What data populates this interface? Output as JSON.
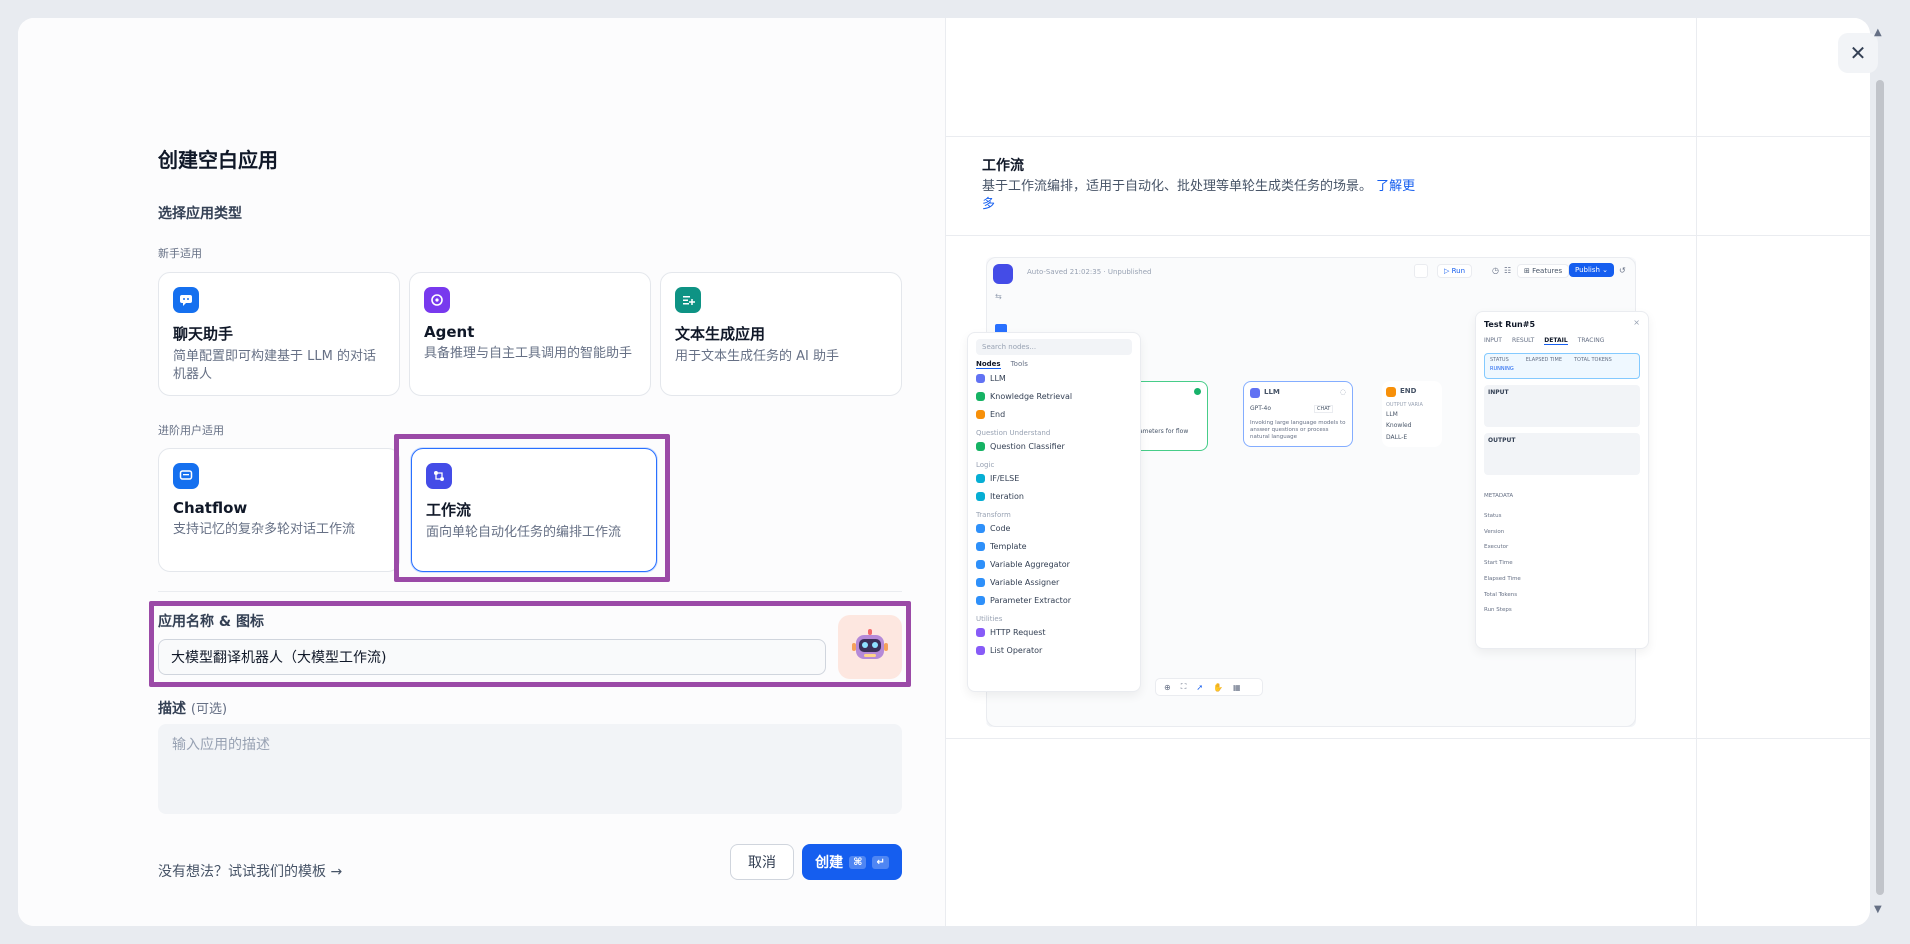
{
  "dialog": {
    "title": "创建空白应用",
    "type_section": "选择应用类型",
    "beginner_label": "新手适用",
    "advanced_label": "进阶用户适用"
  },
  "app_types": {
    "chat": {
      "name": "聊天助手",
      "desc": "简单配置即可构建基于 LLM 的对话机器人",
      "icon": "chat-bubble-icon",
      "color": "#1570ef"
    },
    "agent": {
      "name": "Agent",
      "desc": "具备推理与自主工具调用的智能助手",
      "icon": "robot-icon",
      "color": "#7839ee"
    },
    "text": {
      "name": "文本生成应用",
      "desc": "用于文本生成任务的 AI 助手",
      "icon": "text-generate-icon",
      "color": "#0e9384"
    },
    "chatflow": {
      "name": "Chatflow",
      "desc": "支持记忆的复杂多轮对话工作流",
      "icon": "chatflow-icon",
      "color": "#1570ef"
    },
    "workflow": {
      "name": "工作流",
      "desc": "面向单轮自动化任务的编排工作流",
      "icon": "workflow-icon",
      "color": "#444ce7",
      "selected": true
    }
  },
  "form": {
    "name_label": "应用名称 & 图标",
    "name_value": "大模型翻译机器人（大模型工作流)",
    "desc_label": "描述",
    "desc_optional": "(可选)",
    "desc_placeholder": "输入应用的描述"
  },
  "footer": {
    "template_link": "没有想法？试试我们的模板 →",
    "cancel": "取消",
    "create": "创建",
    "create_kbd1": "⌘",
    "create_kbd2": "↵"
  },
  "preview": {
    "title": "工作流",
    "desc": "基于工作流编排，适用于自动化、批处理等单轮生成类任务的场景。",
    "learn_more": "了解更多",
    "autosave": "Auto-Saved 21:02:35 · Unpublished",
    "run": "Run",
    "features": "Features",
    "publish": "Publish",
    "search_placeholder": "Search nodes...",
    "tabs": [
      "Nodes",
      "Tools"
    ],
    "node_groups": [
      {
        "label": "",
        "items": [
          "LLM",
          "Knowledge Retrieval",
          "End"
        ]
      },
      {
        "label": "Question Understand",
        "items": [
          "Question Classifier"
        ]
      },
      {
        "label": "Logic",
        "items": [
          "IF/ELSE",
          "Iteration"
        ]
      },
      {
        "label": "Transform",
        "items": [
          "Code",
          "Template",
          "Variable Aggregator",
          "Variable Assigner",
          "Parameter Extractor"
        ]
      },
      {
        "label": "Utilities",
        "items": [
          "HTTP Request",
          "List Operator"
        ]
      }
    ],
    "llm_node": {
      "title": "LLM",
      "model": "GPT-4o",
      "badge": "CHAT",
      "desc": "Invoking large language models to answer questions or process natural language"
    },
    "end_node": {
      "title": "END",
      "sub": "OUTPUT VARIA",
      "vars": [
        "LLM",
        "Knowled",
        "DALL-E"
      ]
    },
    "start_desc": "parameters for flow",
    "test_run": {
      "title": "Test Run#5",
      "tabs": [
        "INPUT",
        "RESULT",
        "DETAIL",
        "TRACING"
      ],
      "status_label": "STATUS",
      "status_value": "RUNNING",
      "elapsed_label": "ELAPSED TIME",
      "tokens_label": "TOTAL TOKENS",
      "input_label": "INPUT",
      "output_label": "OUTPUT",
      "metadata_label": "METADATA",
      "meta_rows": [
        "Status",
        "Version",
        "Executor",
        "Start Time",
        "Elapsed Time",
        "Total Tokens",
        "Run Steps"
      ]
    }
  }
}
